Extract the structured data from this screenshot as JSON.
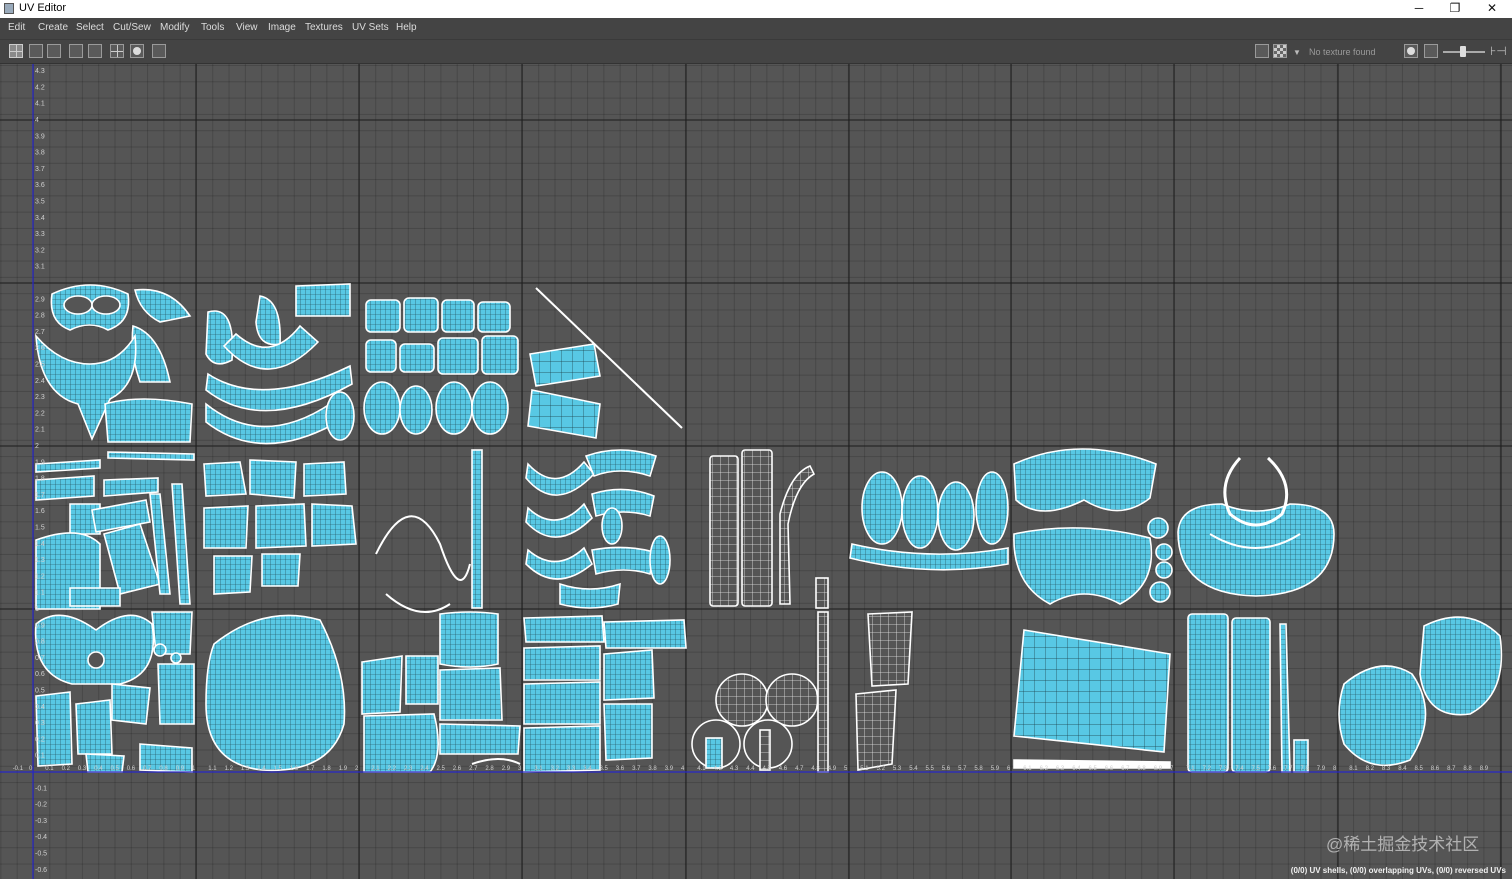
{
  "window": {
    "title": "UV Editor",
    "minimize_glyph": "─",
    "restore_glyph": "❐",
    "close_glyph": "✕"
  },
  "menu": [
    "Edit",
    "Create",
    "Select",
    "Cut/Sew",
    "Modify",
    "Tools",
    "View",
    "Image",
    "Textures",
    "UV Sets",
    "Help"
  ],
  "toolbar": {
    "no_texture_text": "No texture found",
    "left_icons": [
      "grid-toggle-icon",
      "checker-icon",
      "pixel-snap-icon",
      "frame-all-icon",
      "frame-selection-icon",
      "udim-grid-icon",
      "shaded-icon",
      "snapshot-icon"
    ],
    "right_icons": [
      "image-display-icon",
      "checker-display-icon",
      "dropdown-icon",
      "exposure-icon",
      "channel-icon",
      "zoom-slider",
      "toggle-sidebar-icon"
    ]
  },
  "viewport": {
    "status_text": "(0/0) UV shells, (0/0) overlapping UVs, (0/0) reversed UVs",
    "watermark": "@稀土掘金技术社区",
    "colors": {
      "background": "#555555",
      "grid_major": "#1e1e1e",
      "wireframe": "#ffffff",
      "shell_fill": "#58c8e4",
      "axis_line": "#2727c8"
    },
    "v_axis_labels_upper": [
      "4.3",
      "4.2",
      "4.1",
      "4",
      "3.9",
      "3.8",
      "3.7",
      "3.6",
      "3.5",
      "3.4",
      "3.3",
      "3.2",
      "3.1"
    ],
    "v_axis_labels_tile2": [
      "2.9",
      "2.8",
      "2.7",
      "2.6",
      "2.5",
      "2.4",
      "2.3",
      "2.2",
      "2.1",
      "2"
    ],
    "v_axis_labels_tile1": [
      "1.9",
      "1.8",
      "1.7",
      "1.6",
      "1.5",
      "1.4",
      "1.3",
      "1.2",
      "1.1",
      "1"
    ],
    "v_axis_labels_tile0": [
      "0.9",
      "0.8",
      "0.7",
      "0.6",
      "0.5",
      "0.4",
      "0.3",
      "0.2",
      "0.1"
    ],
    "v_axis_labels_negative": [
      "-0.1",
      "-0.2",
      "-0.3",
      "-0.4",
      "-0.5",
      "-0.6"
    ],
    "u_axis_labels": [
      "-0.2",
      "-0.1",
      "0",
      "0.1",
      "0.2",
      "0.3",
      "0.4",
      "0.5",
      "0.6",
      "0.7",
      "0.8",
      "0.9",
      "1",
      "1.1",
      "1.2",
      "1.3",
      "1.4",
      "1.5",
      "1.6",
      "1.7",
      "1.8",
      "1.9",
      "2",
      "2.1",
      "2.2",
      "2.3",
      "2.4",
      "2.5",
      "2.6",
      "2.7",
      "2.8",
      "2.9",
      "3",
      "3.1",
      "3.2",
      "3.3",
      "3.4",
      "3.5",
      "3.6",
      "3.7",
      "3.8",
      "3.9",
      "4",
      "4.1",
      "4.2",
      "4.3",
      "4.4",
      "4.5",
      "4.6",
      "4.7",
      "4.8",
      "4.9",
      "5",
      "5.1",
      "5.2",
      "5.3",
      "5.4",
      "5.5",
      "5.6",
      "5.7",
      "5.8",
      "5.9",
      "6",
      "6.1",
      "6.2",
      "6.3",
      "6.4",
      "6.5",
      "6.6",
      "6.7",
      "6.8",
      "6.9",
      "7",
      "7.1",
      "7.2",
      "7.3",
      "7.4",
      "7.5",
      "7.6",
      "7.7",
      "7.8",
      "7.9",
      "8",
      "8.1",
      "8.2",
      "8.3",
      "8.4",
      "8.5",
      "8.6",
      "8.7",
      "8.8",
      "8.9"
    ],
    "udim_tiles_with_shells": [
      {
        "row": 3,
        "col": 0,
        "type": "face-and-body"
      },
      {
        "row": 3,
        "col": 1,
        "type": "limb-strips"
      },
      {
        "row": 3,
        "col": 2,
        "type": "patch-grid"
      },
      {
        "row": 3,
        "col": 3,
        "type": "card-and-wire"
      },
      {
        "row": 2,
        "col": 0,
        "type": "scattered-strips"
      },
      {
        "row": 2,
        "col": 1,
        "type": "patch-grid"
      },
      {
        "row": 2,
        "col": 2,
        "type": "wire-loop"
      },
      {
        "row": 2,
        "col": 3,
        "type": "curved-shells"
      },
      {
        "row": 2,
        "col": 4,
        "type": "tall-strips"
      },
      {
        "row": 2,
        "col": 5,
        "type": "egg-row"
      },
      {
        "row": 2,
        "col": 6,
        "type": "dome-pair"
      },
      {
        "row": 2,
        "col": 7,
        "type": "ring"
      },
      {
        "row": 1,
        "col": 0,
        "type": "character-head"
      },
      {
        "row": 1,
        "col": 1,
        "type": "big-blob"
      },
      {
        "row": 1,
        "col": 2,
        "type": "torso-pieces"
      },
      {
        "row": 1,
        "col": 3,
        "type": "boxes"
      },
      {
        "row": 1,
        "col": 4,
        "type": "discs"
      },
      {
        "row": 1,
        "col": 5,
        "type": "baskets"
      },
      {
        "row": 1,
        "col": 6,
        "type": "sheet"
      },
      {
        "row": 1,
        "col": 7,
        "type": "tall-strips"
      },
      {
        "row": 1,
        "col": 8,
        "type": "discs-large"
      }
    ]
  }
}
